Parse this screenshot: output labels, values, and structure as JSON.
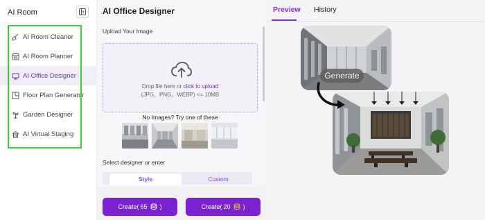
{
  "sidebar": {
    "title": "AI Room",
    "items": [
      {
        "label": "AI Room Cleaner",
        "icon": "broom-icon"
      },
      {
        "label": "AI Room Planner",
        "icon": "planner-icon"
      },
      {
        "label": "AI Office Designer",
        "icon": "office-icon"
      },
      {
        "label": "Floor Plan Generator",
        "icon": "floorplan-icon"
      },
      {
        "label": "Garden Designer",
        "icon": "plant-icon"
      },
      {
        "label": "AI Virtual Staging",
        "icon": "home-icon"
      }
    ],
    "active_index": 2,
    "highlight_color": "#3ad12e"
  },
  "panel": {
    "title": "AI Office Designer",
    "upload_label": "Upload Your Image",
    "drop_prefix": "Drop file here or ",
    "drop_link": "click to upload",
    "drop_formats": "(JPG、PNG、WEBP) <= 10MB",
    "samples_label": "No Images? Try one of these",
    "designer_label": "Select designer or enter",
    "tabs": [
      {
        "label": "Style",
        "selected": true
      },
      {
        "label": "Custom",
        "selected": false
      }
    ],
    "buttons": [
      {
        "prefix": "Create( ",
        "cost": "65",
        "suffix": " )"
      },
      {
        "prefix": "Create( ",
        "cost": "20",
        "suffix": " )"
      }
    ],
    "accent_color": "#7a22d2"
  },
  "preview": {
    "tabs": [
      {
        "label": "Preview",
        "active": true
      },
      {
        "label": "History",
        "active": false
      }
    ],
    "generate_label": "Generate"
  }
}
